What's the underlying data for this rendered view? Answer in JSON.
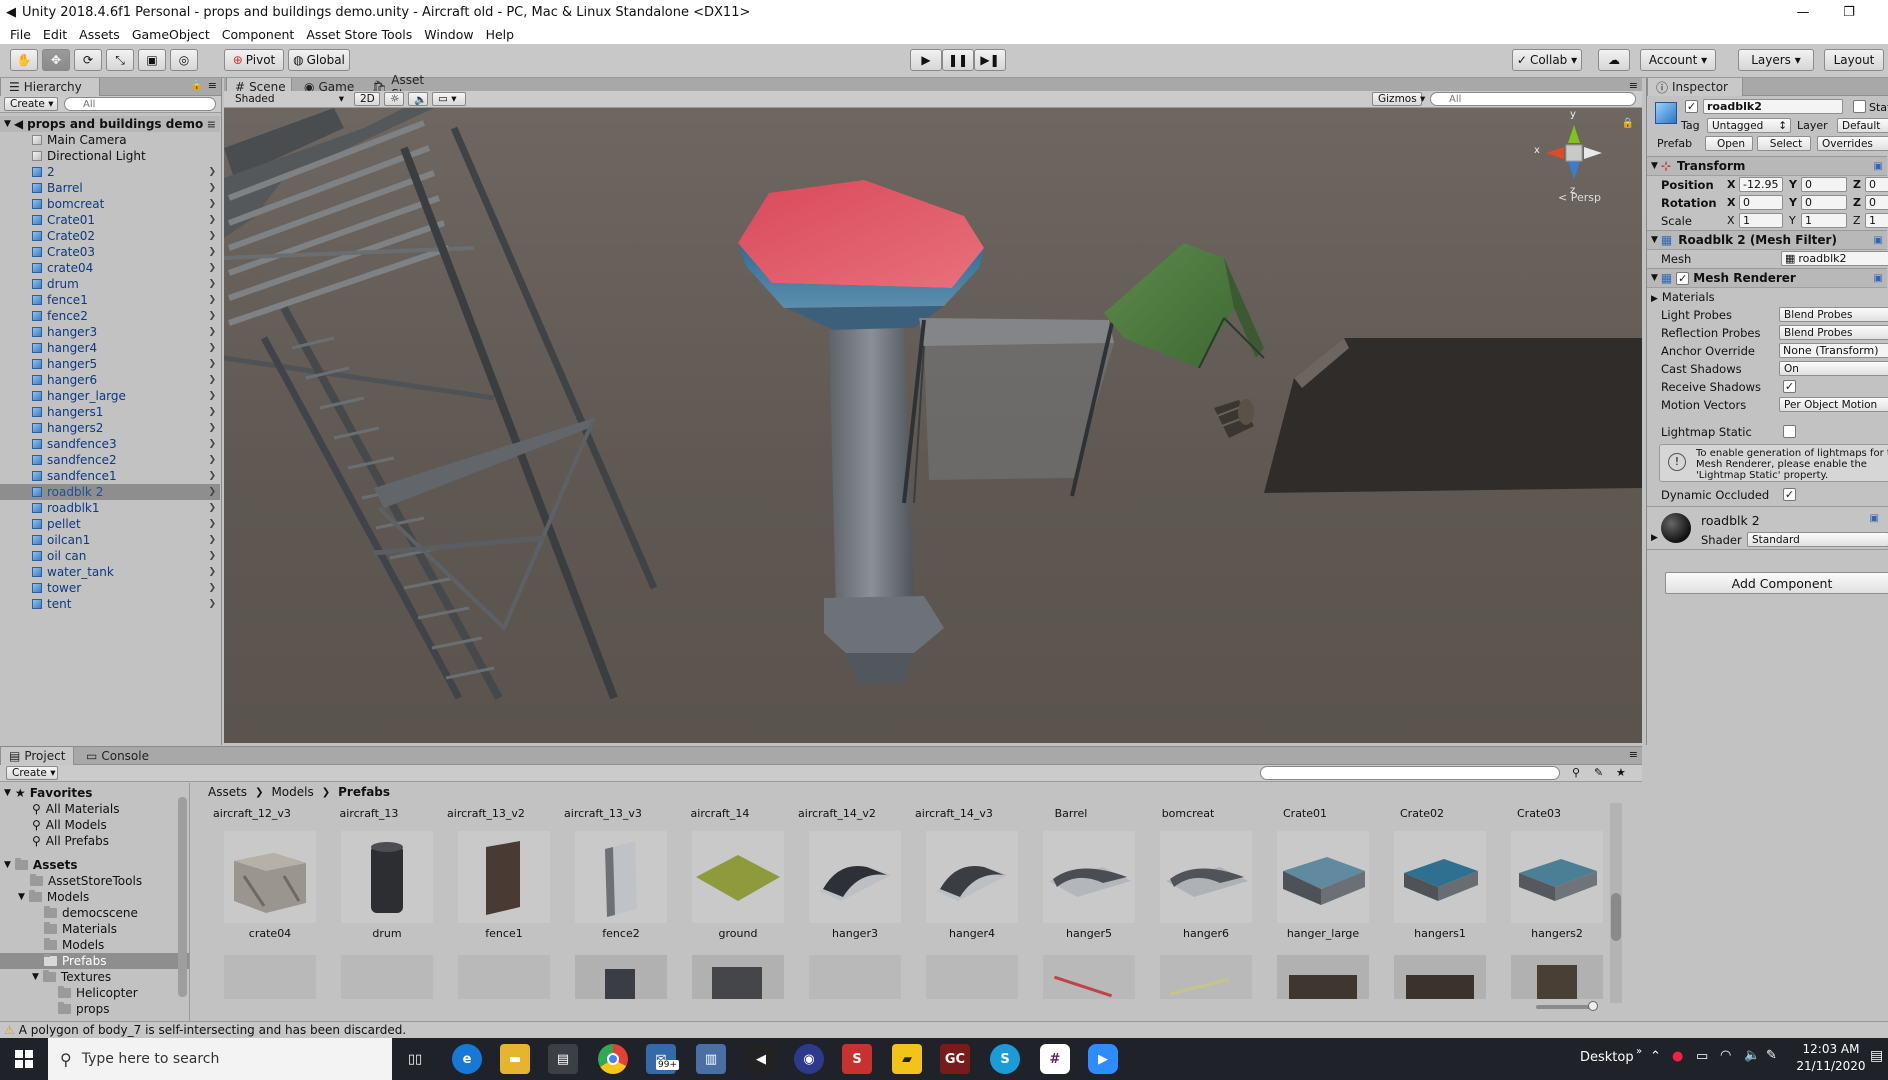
{
  "window": {
    "title": "Unity 2018.4.6f1 Personal - props and buildings demo.unity - Aircraft old - PC, Mac & Linux Standalone <DX11>"
  },
  "menu": [
    "File",
    "Edit",
    "Assets",
    "GameObject",
    "Component",
    "Asset Store Tools",
    "Window",
    "Help"
  ],
  "toolbar": {
    "pivot": "Pivot",
    "global": "Global",
    "collab": "Collab",
    "account": "Account",
    "layers": "Layers",
    "layout": "Layout"
  },
  "hierarchy": {
    "tab": "Hierarchy",
    "create": "Create",
    "search_placeholder": "All",
    "scene": "props and buildings demo",
    "items": [
      "Main Camera",
      "Directional Light",
      "2",
      "Barrel",
      "bomcreat",
      "Crate01",
      "Crate02",
      "Crate03",
      "crate04",
      "drum",
      "fence1",
      "fence2",
      "hanger3",
      "hanger4",
      "hanger5",
      "hanger6",
      "hanger_large",
      "hangers1",
      "hangers2",
      "sandfence3",
      "sandfence2",
      "sandfence1",
      "roadblk 2",
      "roadblk1",
      "pellet",
      "oilcan1",
      "oil can",
      "water_tank",
      "tower",
      "tent"
    ],
    "selected": "roadblk 2"
  },
  "scene": {
    "tabs": [
      "Scene",
      "Game",
      "Asset Store"
    ],
    "shading": "Shaded",
    "mode2d": "2D",
    "gizmos": "Gizmos",
    "search_placeholder": "All",
    "persp": "Persp",
    "axis_x": "x",
    "axis_y": "y",
    "axis_z": "z"
  },
  "inspector": {
    "tab": "Inspector",
    "name": "roadblk2",
    "static": "Static",
    "tag_label": "Tag",
    "tag": "Untagged",
    "layer_label": "Layer",
    "layer": "Default",
    "prefab_label": "Prefab",
    "open": "Open",
    "select": "Select",
    "overrides": "Overrides",
    "transform": "Transform",
    "position_label": "Position",
    "rotation_label": "Rotation",
    "scale_label": "Scale",
    "position": {
      "x": "-12.95",
      "y": "0",
      "z": "0"
    },
    "rotation": {
      "x": "0",
      "y": "0",
      "z": "0"
    },
    "scale": {
      "x": "1",
      "y": "1",
      "z": "1"
    },
    "mesh_filter": "Roadblk 2 (Mesh Filter)",
    "mesh_label": "Mesh",
    "mesh": "roadblk2",
    "mesh_renderer": "Mesh Renderer",
    "materials": "Materials",
    "light_probes_label": "Light Probes",
    "light_probes": "Blend Probes",
    "reflection_probes_label": "Reflection Probes",
    "reflection_probes": "Blend Probes",
    "anchor_override_label": "Anchor Override",
    "anchor_override": "None (Transform)",
    "cast_shadows_label": "Cast Shadows",
    "cast_shadows": "On",
    "receive_shadows_label": "Receive Shadows",
    "motion_vectors_label": "Motion Vectors",
    "motion_vectors": "Per Object Motion",
    "lightmap_static_label": "Lightmap Static",
    "lightmap_info": [
      "To enable generation of lightmaps for t",
      "Mesh Renderer, please enable the",
      "'Lightmap Static' property."
    ],
    "dynamic_occluded_label": "Dynamic Occluded",
    "material_name": "roadblk 2",
    "shader_label": "Shader",
    "shader": "Standard",
    "add_component": "Add Component"
  },
  "project": {
    "tabs": [
      "Project",
      "Console"
    ],
    "create": "Create",
    "favorites": "Favorites",
    "fav_items": [
      "All Materials",
      "All Models",
      "All Prefabs"
    ],
    "assets": "Assets",
    "tree": [
      {
        "label": "AssetStoreTools",
        "indent": 1
      },
      {
        "label": "Models",
        "indent": 1
      },
      {
        "label": "democscene",
        "indent": 2
      },
      {
        "label": "Materials",
        "indent": 2
      },
      {
        "label": "Models",
        "indent": 2
      },
      {
        "label": "Prefabs",
        "indent": 2
      },
      {
        "label": "Textures",
        "indent": 2
      },
      {
        "label": "Helicopter",
        "indent": 3
      },
      {
        "label": "props",
        "indent": 3
      }
    ],
    "breadcrumb": [
      "Assets",
      "Models",
      "Prefabs"
    ],
    "row0_labels": [
      "aircraft_12_v3",
      "aircraft_13",
      "aircraft_13_v2",
      "aircraft_13_v3",
      "aircraft_14",
      "aircraft_14_v2",
      "aircraft_14_v3",
      "Barrel",
      "bomcreat",
      "Crate01",
      "Crate02",
      "Crate03"
    ],
    "row1_labels": [
      "crate04",
      "drum",
      "fence1",
      "fence2",
      "ground",
      "hanger3",
      "hanger4",
      "hanger5",
      "hanger6",
      "hanger_large",
      "hangers1",
      "hangers2"
    ]
  },
  "status": {
    "message": "A polygon of body_7 is self-intersecting and has been discarded."
  },
  "taskbar": {
    "search_placeholder": "Type here to search",
    "desktop": "Desktop",
    "time": "12:03 AM",
    "date": "21/11/2020",
    "badge": "99+"
  },
  "colors": {
    "accent": "#1f6fd6",
    "selection": "#8e8e8e",
    "taskbar": "#1f2228"
  }
}
